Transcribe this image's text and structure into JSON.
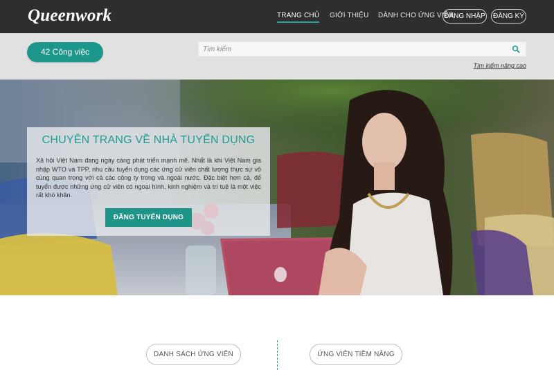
{
  "header": {
    "logo": "Queenwork",
    "nav": [
      {
        "label": "TRANG CHỦ",
        "active": true
      },
      {
        "label": "GIỚI THIỆU",
        "active": false
      },
      {
        "label": "DÀNH CHO ỨNG VIÊN",
        "active": false
      }
    ],
    "login_label": "ĐĂNG NHẬP",
    "register_label": "ĐĂNG KÝ"
  },
  "search": {
    "jobs_count_label": "42 Công việc",
    "placeholder": "Tìm kiếm",
    "advanced_label": "Tìm kiếm nâng cao",
    "icon": "search-icon"
  },
  "hero": {
    "title": "CHUYÊN TRANG VỀ NHÀ TUYỂN DỤNG",
    "text": "Xã hội Việt Nam đang ngày càng phát triển mạnh mẽ. Nhất là khi Việt Nam gia nhập WTO và TPP, nhu cầu tuyển dụng các ứng cử viên chất lượng thực sự vô cùng quan trọng với cả các công ty trong và ngoài nước. Đặc biệt hơn cả, để tuyển được những ứng cử viên có ngoại hình, kinh nghiệm và trí tuệ là một việc rất khó khăn.",
    "button_label": "ĐĂNG TUYỂN DỤNG"
  },
  "bottom": {
    "candidates_label": "DANH SÁCH ỨNG VIÊN",
    "potential_label": "ỨNG VIÊN TIỀM NĂNG"
  },
  "colors": {
    "accent": "#1f9b90",
    "topbar": "#2e2e2e",
    "strip": "#e1e1e1"
  }
}
